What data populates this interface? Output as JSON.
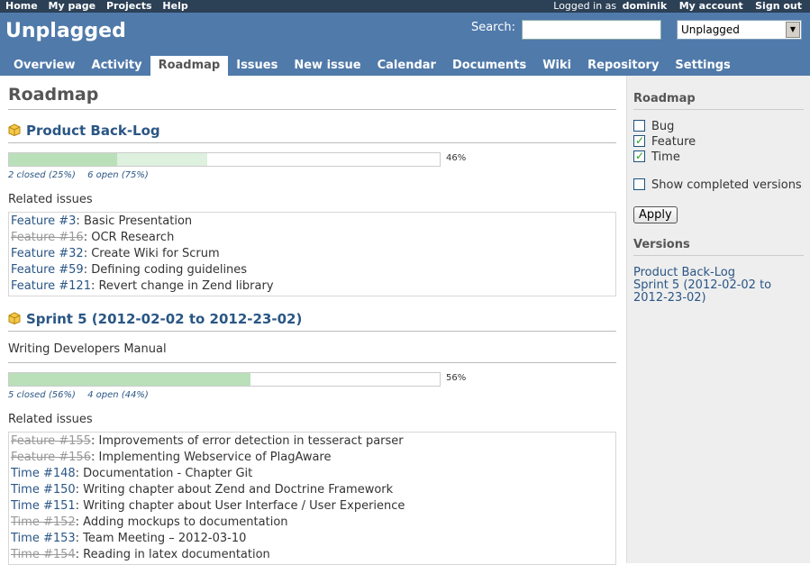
{
  "top_menu": {
    "left": [
      "Home",
      "My page",
      "Projects",
      "Help"
    ],
    "logged_in_prefix": "Logged in as",
    "user": "dominik",
    "my_account": "My account",
    "sign_out": "Sign out"
  },
  "header": {
    "title": "Unplagged",
    "search_label": "Search:",
    "search_value": "",
    "project_select": "Unplagged"
  },
  "main_menu": {
    "items": [
      "Overview",
      "Activity",
      "Roadmap",
      "Issues",
      "New issue",
      "Calendar",
      "Documents",
      "Wiki",
      "Repository",
      "Settings"
    ],
    "selected": "Roadmap"
  },
  "page": {
    "title": "Roadmap",
    "versions": [
      {
        "name": "Product Back-Log",
        "description": "",
        "closed_pct": 25,
        "done_pct": 46,
        "pct_label": "46%",
        "closed_label": "2 closed",
        "closed_pct_label": "(25%)",
        "open_label": "6 open",
        "open_pct_label": "(75%)",
        "related_label": "Related issues",
        "issues": [
          {
            "ref": "Feature #3",
            "subject": "Basic Presentation",
            "closed": false
          },
          {
            "ref": "Feature #16",
            "subject": "OCR Research",
            "closed": true
          },
          {
            "ref": "Feature #32",
            "subject": "Create Wiki for Scrum",
            "closed": false
          },
          {
            "ref": "Feature #59",
            "subject": "Defining coding guidelines",
            "closed": false
          },
          {
            "ref": "Feature #121",
            "subject": "Revert change in Zend library",
            "closed": false
          }
        ]
      },
      {
        "name": "Sprint 5 (2012-02-02 to 2012-23-02)",
        "description": "Writing Developers Manual",
        "closed_pct": 56,
        "done_pct": 56,
        "pct_label": "56%",
        "closed_label": "5 closed",
        "closed_pct_label": "(56%)",
        "open_label": "4 open",
        "open_pct_label": "(44%)",
        "related_label": "Related issues",
        "issues": [
          {
            "ref": "Feature #155",
            "subject": "Improvements of error detection in tesseract parser",
            "closed": true
          },
          {
            "ref": "Feature #156",
            "subject": "Implementing Webservice of PlagAware",
            "closed": true
          },
          {
            "ref": "Time #148",
            "subject": "Documentation - Chapter Git",
            "closed": false
          },
          {
            "ref": "Time #150",
            "subject": "Writing chapter about Zend and Doctrine Framework",
            "closed": false
          },
          {
            "ref": "Time #151",
            "subject": "Writing chapter about User Interface / User Experience",
            "closed": false
          },
          {
            "ref": "Time #152",
            "subject": "Adding mockups to documentation",
            "closed": true
          },
          {
            "ref": "Time #153",
            "subject": "Team Meeting – 2012-03-10",
            "closed": false
          },
          {
            "ref": "Time #154",
            "subject": "Reading in latex documentation",
            "closed": true
          }
        ]
      }
    ]
  },
  "sidebar": {
    "roadmap_title": "Roadmap",
    "trackers": [
      {
        "label": "Bug",
        "checked": false
      },
      {
        "label": "Feature",
        "checked": true
      },
      {
        "label": "Time",
        "checked": true
      }
    ],
    "show_completed": {
      "label": "Show completed versions",
      "checked": false
    },
    "apply_label": "Apply",
    "versions_title": "Versions",
    "version_links": [
      "Product Back-Log",
      "Sprint 5 (2012-02-02 to 2012-23-02)"
    ]
  },
  "colors": {
    "header_bg": "#507AAA",
    "top_menu_bg": "#2C4056",
    "link": "#2A5685",
    "progress_closed": "#BAE0BA",
    "progress_done": "#DEF0DE"
  }
}
